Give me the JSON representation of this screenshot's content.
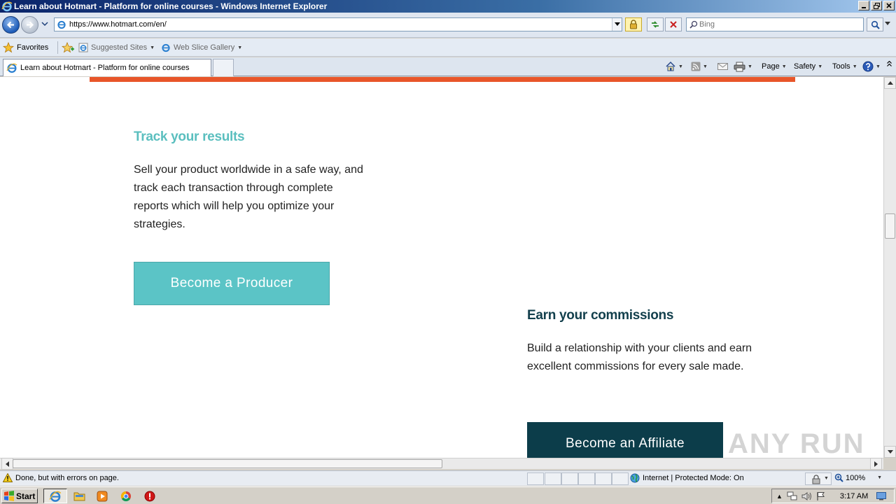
{
  "window": {
    "title": "Learn about Hotmart - Platform for online courses - Windows Internet Explorer"
  },
  "address_bar": {
    "url": "https://www.hotmart.com/en/",
    "search_placeholder": "Bing"
  },
  "favorites_bar": {
    "favorites_label": "Favorites",
    "items": [
      "Suggested Sites",
      "Web Slice Gallery"
    ]
  },
  "tab": {
    "label": "Learn about Hotmart - Platform for online courses"
  },
  "command_bar": {
    "page_label": "Page",
    "safety_label": "Safety",
    "tools_label": "Tools"
  },
  "content": {
    "producer": {
      "title": "Track your results",
      "description": "Sell your product worldwide in a safe way, and track each transaction through complete reports which will help you optimize your strategies.",
      "button_label": "Become a Producer"
    },
    "affiliate": {
      "title": "Earn your commissions",
      "description": "Build a relationship with your clients and earn excellent commissions for every sale made.",
      "button_label": "Become an Affiliate"
    },
    "watermark": "ANY RUN"
  },
  "status_bar": {
    "message": "Done, but with errors on page.",
    "zone": "Internet | Protected Mode: On",
    "zoom": "100%"
  },
  "taskbar": {
    "start_label": "Start",
    "clock": "3:17 AM"
  },
  "colors": {
    "accent_orange": "#e8562a",
    "teal": "#5bc4c6",
    "teal_title": "#5bbfbf",
    "dark_teal": "#0c3d4a",
    "dark_title": "#123f4c"
  }
}
